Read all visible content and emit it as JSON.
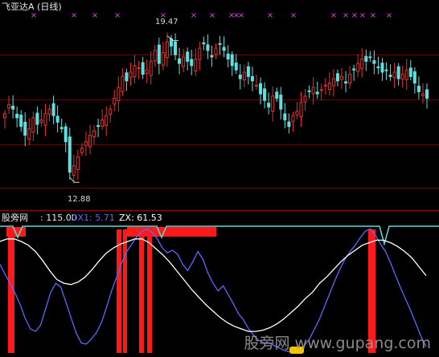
{
  "header": {
    "title": "飞亚达A (日线)"
  },
  "indicator": {
    "name": "股旁网",
    "value": ": 115.00",
    "dx1": "DX1: 5.71",
    "zx": "ZX: 61.53"
  },
  "annotations": {
    "high": "19.47",
    "low": "12.88"
  },
  "watermark": "股旁网 www.gupang.com",
  "colors": {
    "background": "#000000",
    "grid": "#7a0000",
    "separator": "#9a0000",
    "candle_up": "#e8302e",
    "candle_down": "#5fe0e0",
    "marker": "#e040e0",
    "cyan_line": "#5fd8d8",
    "dx1_line": "#5a67ff",
    "zx_line": "#ffffff",
    "signal_bar": "#ff1a1a"
  },
  "chart_data": [
    {
      "type": "candlestick",
      "title": "飞亚达A (日线)",
      "price_range": [
        11.6,
        20.6
      ],
      "high": 19.47,
      "low": 12.88,
      "closes": [
        15.9,
        16.3,
        16.1,
        15.7,
        15.3,
        14.9,
        15.2,
        15.7,
        15.4,
        15.6,
        15.9,
        16.1,
        15.8,
        15.5,
        15.2,
        14.6,
        13.2,
        13.5,
        13.9,
        14.3,
        14.6,
        14.9,
        15.1,
        15.3,
        15.6,
        15.8,
        16.1,
        16.6,
        17.1,
        17.6,
        17.4,
        17.8,
        18.1,
        18.0,
        17.7,
        17.9,
        18.3,
        18.8,
        18.2,
        18.7,
        19.2,
        19.0,
        18.6,
        18.2,
        18.5,
        18.3,
        18.1,
        18.4,
        18.9,
        19.1,
        18.8,
        18.5,
        18.9,
        19.1,
        18.8,
        18.4,
        18.1,
        17.9,
        17.5,
        17.8,
        17.6,
        17.4,
        17.2,
        16.8,
        16.5,
        16.2,
        16.7,
        16.6,
        16.1,
        15.6,
        15.3,
        15.8,
        16.0,
        16.4,
        16.7,
        16.9,
        17.1,
        16.8,
        17.0,
        17.2,
        17.3,
        17.5,
        17.4,
        17.6,
        17.3,
        17.7,
        17.9,
        18.2,
        18.4,
        18.3,
        18.5,
        18.2,
        18.0,
        17.8,
        17.9,
        17.6,
        17.8,
        17.5,
        17.7,
        17.9,
        17.6,
        17.3,
        16.9,
        16.8,
        16.6
      ]
    },
    {
      "type": "line",
      "title": "股旁网",
      "value": 115.0,
      "series": [
        {
          "name": "DX1",
          "last": 5.71,
          "values": [
            70,
            62,
            55,
            47,
            38,
            27,
            19,
            17,
            22,
            35,
            48,
            55,
            52,
            40,
            28,
            16,
            8,
            7,
            11,
            16,
            24,
            36,
            49,
            60,
            71,
            80,
            86,
            92,
            96,
            98,
            95,
            90,
            83,
            79,
            81,
            78,
            70,
            65,
            72,
            80,
            74,
            63,
            55,
            49,
            53,
            46,
            39,
            31,
            26,
            19,
            14,
            10,
            8,
            8,
            6,
            4,
            2,
            1,
            0,
            2,
            6,
            11,
            19,
            27,
            37,
            47,
            57,
            66,
            74,
            80,
            85,
            91,
            96,
            98,
            93,
            86,
            80,
            71,
            61,
            51,
            42,
            33,
            23,
            13,
            5
          ]
        },
        {
          "name": "ZX",
          "last": 61.53,
          "values": [
            88,
            90,
            90,
            88,
            85,
            80,
            73,
            65,
            58,
            55,
            54,
            56,
            60,
            66,
            73,
            79,
            83,
            86,
            88,
            90,
            90,
            87,
            82,
            77,
            71,
            64,
            57,
            50,
            44,
            38,
            33,
            28,
            24,
            21,
            19,
            17,
            17,
            18,
            20,
            23,
            27,
            32,
            37,
            43,
            48,
            55,
            60,
            66,
            72,
            77,
            81,
            85,
            87,
            89,
            89,
            87,
            84,
            80,
            75,
            68,
            61
          ]
        }
      ]
    }
  ]
}
